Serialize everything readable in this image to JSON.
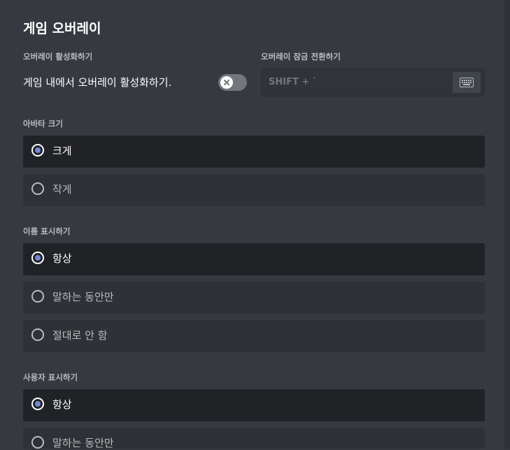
{
  "page": {
    "title": "게임 오버레이"
  },
  "overlay": {
    "enable_label": "오버레이 활성화하기",
    "enable_text": "게임 내에서 오버레이 활성화하기.",
    "enabled": false,
    "toggle_icon": "x-icon",
    "lock_label": "오버레이 잠금 전환하기",
    "lock_keybind": "SHIFT + `",
    "record_icon": "keyboard-icon"
  },
  "avatar_size": {
    "label": "아바타 크기",
    "options": [
      {
        "label": "크게",
        "selected": true
      },
      {
        "label": "작게",
        "selected": false
      }
    ]
  },
  "display_names": {
    "label": "이름 표시하기",
    "options": [
      {
        "label": "항상",
        "selected": true
      },
      {
        "label": "말하는 동안만",
        "selected": false
      },
      {
        "label": "절대로 안 함",
        "selected": false
      }
    ]
  },
  "display_users": {
    "label": "사용자 표시하기",
    "options": [
      {
        "label": "항상",
        "selected": true
      },
      {
        "label": "말하는 동안만",
        "selected": false
      }
    ]
  },
  "colors": {
    "background": "#36393f",
    "selected_option": "#202225",
    "option": "#2f3136",
    "accent": "#7289da"
  }
}
